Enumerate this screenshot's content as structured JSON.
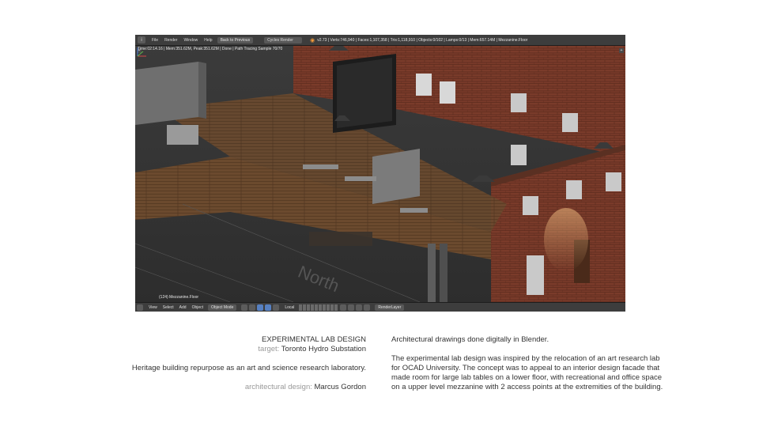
{
  "window": {
    "editor_icon": "i",
    "menu": [
      "File",
      "Render",
      "Window",
      "Help"
    ],
    "back_button": "Back to Previous",
    "render_engine": "Cycles Render",
    "stats": "v2.73 | Verts:746,940 | Faces:1,107,358 | Tris:1,118,910 | Objects:0/102 | Lamps:0/13 | Mem:657.14M | Mezzanine.Floor"
  },
  "viewport": {
    "render_status": "Time:02:14.16 | Mem:351.62M, Peak:351.62M | Done | Path Tracing Sample 70/70",
    "object_label": "(124) Mezzanine.Floor",
    "watermark_text": "North",
    "corner_left": "+",
    "corner_right": "+"
  },
  "bottombar": {
    "menu": [
      "View",
      "Select",
      "Add",
      "Object"
    ],
    "mode": "Object Mode",
    "pivot": "Local",
    "render_layer": "RenderLayer"
  },
  "caption": {
    "title": "EXPERIMENTAL LAB DESIGN",
    "target_label": "target:",
    "target_value": "Toronto Hydro Substation",
    "summary": "Heritage building repurpose as an art and science research laboratory.",
    "design_label": "architectural design:",
    "design_value": "Marcus Gordon"
  },
  "description": {
    "line1": "Architectural drawings done digitally in Blender.",
    "paragraph": "The experimental lab design was inspired by the relocation of an art research lab for OCAD University.  The concept was to appeal to an interior design facade that made room for large lab tables on a lower floor, with recreational and office space on a upper level mezzanine with 2 access points at the extremities of the building."
  },
  "colors": {
    "brick": "#7a3b2a",
    "wood": "#6b4a2e",
    "concrete": "#7b7b7b",
    "ui_bg": "#3d3d3d",
    "blender_orange": "#f29a3a"
  },
  "icons": [
    "blender-logo-icon",
    "axis-gizmo-icon"
  ]
}
